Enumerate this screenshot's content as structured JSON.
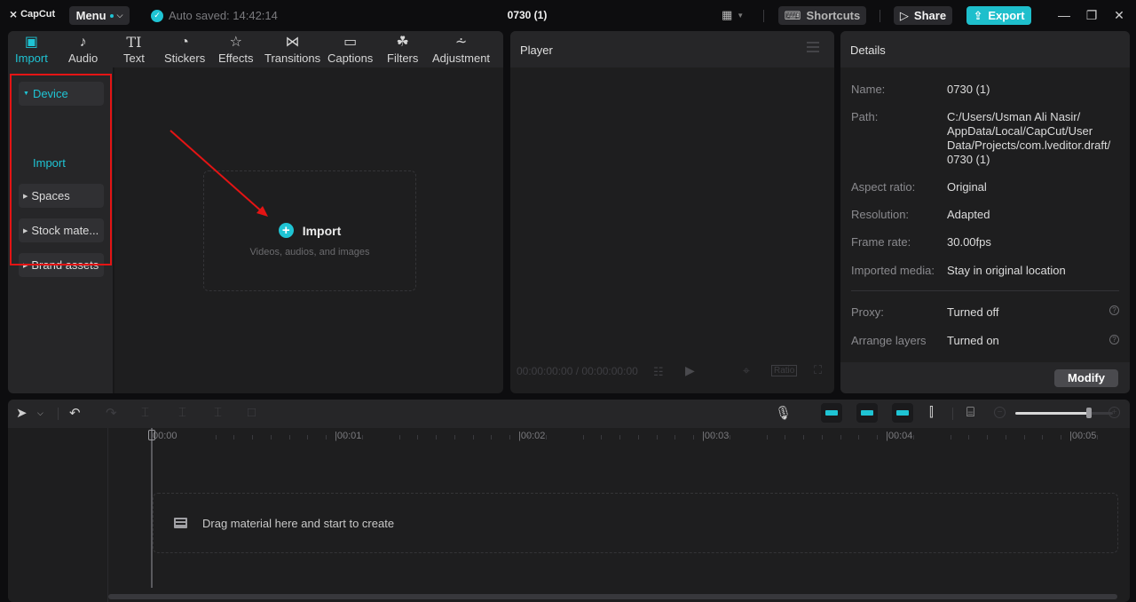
{
  "titlebar": {
    "app_name": "CapCut",
    "menu_label": "Menu",
    "autosave_text": "Auto saved: 14:42:14",
    "project_title": "0730 (1)",
    "shortcuts_label": "Shortcuts",
    "share_label": "Share",
    "export_label": "Export",
    "accent_color": "#1fc4d4"
  },
  "media": {
    "tabs": [
      {
        "label": "Import",
        "icon": "import-icon",
        "active": true
      },
      {
        "label": "Audio",
        "icon": "audio-icon"
      },
      {
        "label": "Text",
        "icon": "text-icon"
      },
      {
        "label": "Stickers",
        "icon": "stickers-icon"
      },
      {
        "label": "Effects",
        "icon": "effects-icon"
      },
      {
        "label": "Transitions",
        "icon": "transitions-icon"
      },
      {
        "label": "Captions",
        "icon": "captions-icon"
      },
      {
        "label": "Filters",
        "icon": "filters-icon"
      },
      {
        "label": "Adjustment",
        "icon": "adjustment-icon"
      }
    ],
    "sidebar": {
      "items": [
        {
          "label": "Device",
          "expanded": true
        },
        {
          "label": "Spaces"
        },
        {
          "label": "Stock mate..."
        },
        {
          "label": "Brand assets"
        }
      ],
      "sub_item": "Import"
    },
    "import_area": {
      "title": "Import",
      "subtitle": "Videos, audios, and images"
    }
  },
  "player": {
    "title": "Player",
    "timecode": "00:00:00:00 / 00:00:00:00",
    "ratio_label": "Ratio"
  },
  "details": {
    "title": "Details",
    "rows": [
      {
        "label": "Name:",
        "value": "0730 (1)"
      },
      {
        "label": "Path:",
        "value": "C:/Users/Usman Ali Nasir/ AppData/Local/CapCut/User Data/Projects/com.lveditor.draft/ 0730 (1)"
      },
      {
        "label": "Aspect ratio:",
        "value": "Original"
      },
      {
        "label": "Resolution:",
        "value": "Adapted"
      },
      {
        "label": "Frame rate:",
        "value": "30.00fps"
      },
      {
        "label": "Imported media:",
        "value": "Stay in original location"
      },
      {
        "label": "Proxy:",
        "value": "Turned off"
      },
      {
        "label": "Arrange layers",
        "value": "Turned on"
      }
    ],
    "modify_label": "Modify"
  },
  "timeline": {
    "ruler_labels": [
      "00:00",
      "|00:01",
      "|00:02",
      "|00:03",
      "|00:04",
      "|00:05"
    ],
    "drop_text": "Drag material here and start to create",
    "zoom_level": 0.75
  }
}
